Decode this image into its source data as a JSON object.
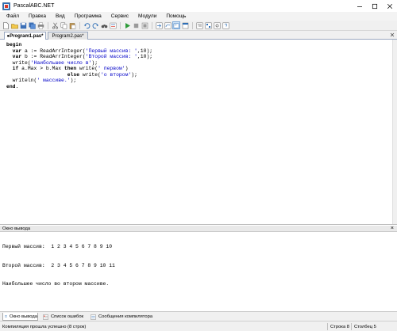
{
  "window": {
    "title": "PascalABC.NET"
  },
  "menu": [
    "Файл",
    "Правка",
    "Вид",
    "Программа",
    "Сервис",
    "Модули",
    "Помощь"
  ],
  "tabs": [
    {
      "label": "●Program1.pas*",
      "active": true
    },
    {
      "label": "Program2.pas*",
      "active": false
    }
  ],
  "editor": {
    "lines": [
      [
        {
          "t": "kw",
          "v": "begin"
        }
      ],
      [
        {
          "t": "plain",
          "v": "  "
        },
        {
          "t": "kw",
          "v": "var"
        },
        {
          "t": "plain",
          "v": " a := ReadArrInteger("
        },
        {
          "t": "str",
          "v": "'Первый массив: '"
        },
        {
          "t": "plain",
          "v": ",10);"
        }
      ],
      [
        {
          "t": "plain",
          "v": "  "
        },
        {
          "t": "kw",
          "v": "var"
        },
        {
          "t": "plain",
          "v": " b := ReadArrInteger("
        },
        {
          "t": "str",
          "v": "'Второй массив: '"
        },
        {
          "t": "plain",
          "v": ",10);"
        }
      ],
      [
        {
          "t": "plain",
          "v": "  write("
        },
        {
          "t": "str",
          "v": "'Наибольшее число в'"
        },
        {
          "t": "plain",
          "v": ");"
        }
      ],
      [
        {
          "t": "plain",
          "v": "  "
        },
        {
          "t": "kw",
          "v": "if"
        },
        {
          "t": "plain",
          "v": " a.Max > b.Max "
        },
        {
          "t": "kw",
          "v": "then"
        },
        {
          "t": "plain",
          "v": " write("
        },
        {
          "t": "str",
          "v": "' первом'"
        },
        {
          "t": "plain",
          "v": ")"
        }
      ],
      [
        {
          "t": "plain",
          "v": "                    "
        },
        {
          "t": "kw",
          "v": "else"
        },
        {
          "t": "plain",
          "v": " write("
        },
        {
          "t": "str",
          "v": "'о втором'"
        },
        {
          "t": "plain",
          "v": ");"
        }
      ],
      [
        {
          "t": "plain",
          "v": "  writeln("
        },
        {
          "t": "str",
          "v": "' массиве.'"
        },
        {
          "t": "plain",
          "v": ");"
        }
      ],
      [
        {
          "t": "kw",
          "v": "end"
        },
        {
          "t": "plain",
          "v": "."
        }
      ]
    ]
  },
  "output_panel": {
    "title": "Окно вывода",
    "close": "×",
    "lines": [
      "Первый массив:  1 2 3 4 5 6 7 8 9 10",
      "Второй массив:  2 3 4 5 6 7 8 9 10 11",
      "Наибольшее число во втором массиве."
    ]
  },
  "bottom_tabs": [
    "Окно вывода",
    "Список ошибок",
    "Сообщения компилятора"
  ],
  "status": {
    "message": "Компиляция прошла успешно (8 строк)",
    "line_label": "Строка 8",
    "col_label": "Столбец 5"
  },
  "colors": {
    "keyword": "#000000",
    "string": "#0000c8",
    "accent": "#3a78c8"
  }
}
